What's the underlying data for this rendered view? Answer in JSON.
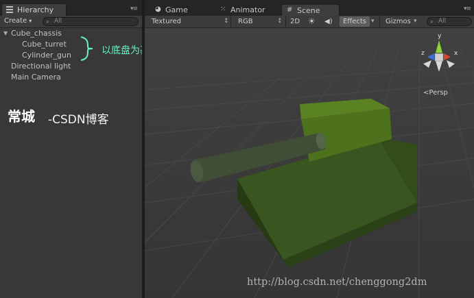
{
  "hierarchy": {
    "tab_label": "Hierarchy",
    "panel_menu": "▾≡",
    "create_label": "Create",
    "create_arrow": "▾",
    "search_placeholder": "All",
    "items": [
      {
        "label": "Cube_chassis",
        "expanded": true
      },
      {
        "label": "Cube_turret"
      },
      {
        "label": "Cylinder_gun"
      },
      {
        "label": "Directional light"
      },
      {
        "label": "Main Camera"
      }
    ]
  },
  "annotation": {
    "note": "以底盘为基础，合并mesh，形成新模型",
    "color": "#6af2c0"
  },
  "watermark": {
    "name": "常城",
    "source": "-CSDN博客",
    "url": "http://blog.csdn.net/chenggong2dm"
  },
  "scene_tabs": [
    {
      "label": "Game",
      "icon": "game-icon",
      "glyph": "◕"
    },
    {
      "label": "Animator",
      "icon": "animator-icon",
      "glyph": "⁙"
    },
    {
      "label": "Scene",
      "icon": "scene-grid-icon",
      "glyph": "#",
      "active": true
    }
  ],
  "scene_toolbar": {
    "panel_menu": "▾≡",
    "shading_mode": "Textured",
    "render_mode": "RGB",
    "mode_2d": "2D",
    "lighting_glyph": "☀",
    "audio_glyph": "◀)",
    "effects_label": "Effects",
    "gizmos_label": "Gizmos",
    "dropdown_glyph": "▾",
    "stepper_glyph": "↕",
    "search_placeholder": "All"
  },
  "scene_view": {
    "projection_label": "Persp",
    "gizmo_axes": {
      "x": "x",
      "y": "y",
      "z": "z"
    },
    "colors": {
      "background": "#3b3b3b",
      "grid": "#4a4a4a",
      "chassis": "#385220",
      "turret": "#4a6e1a",
      "gun": "#3d4c32",
      "axis_x": "#e0452e",
      "axis_y": "#8bd43a",
      "axis_z": "#3a6fd6"
    }
  }
}
